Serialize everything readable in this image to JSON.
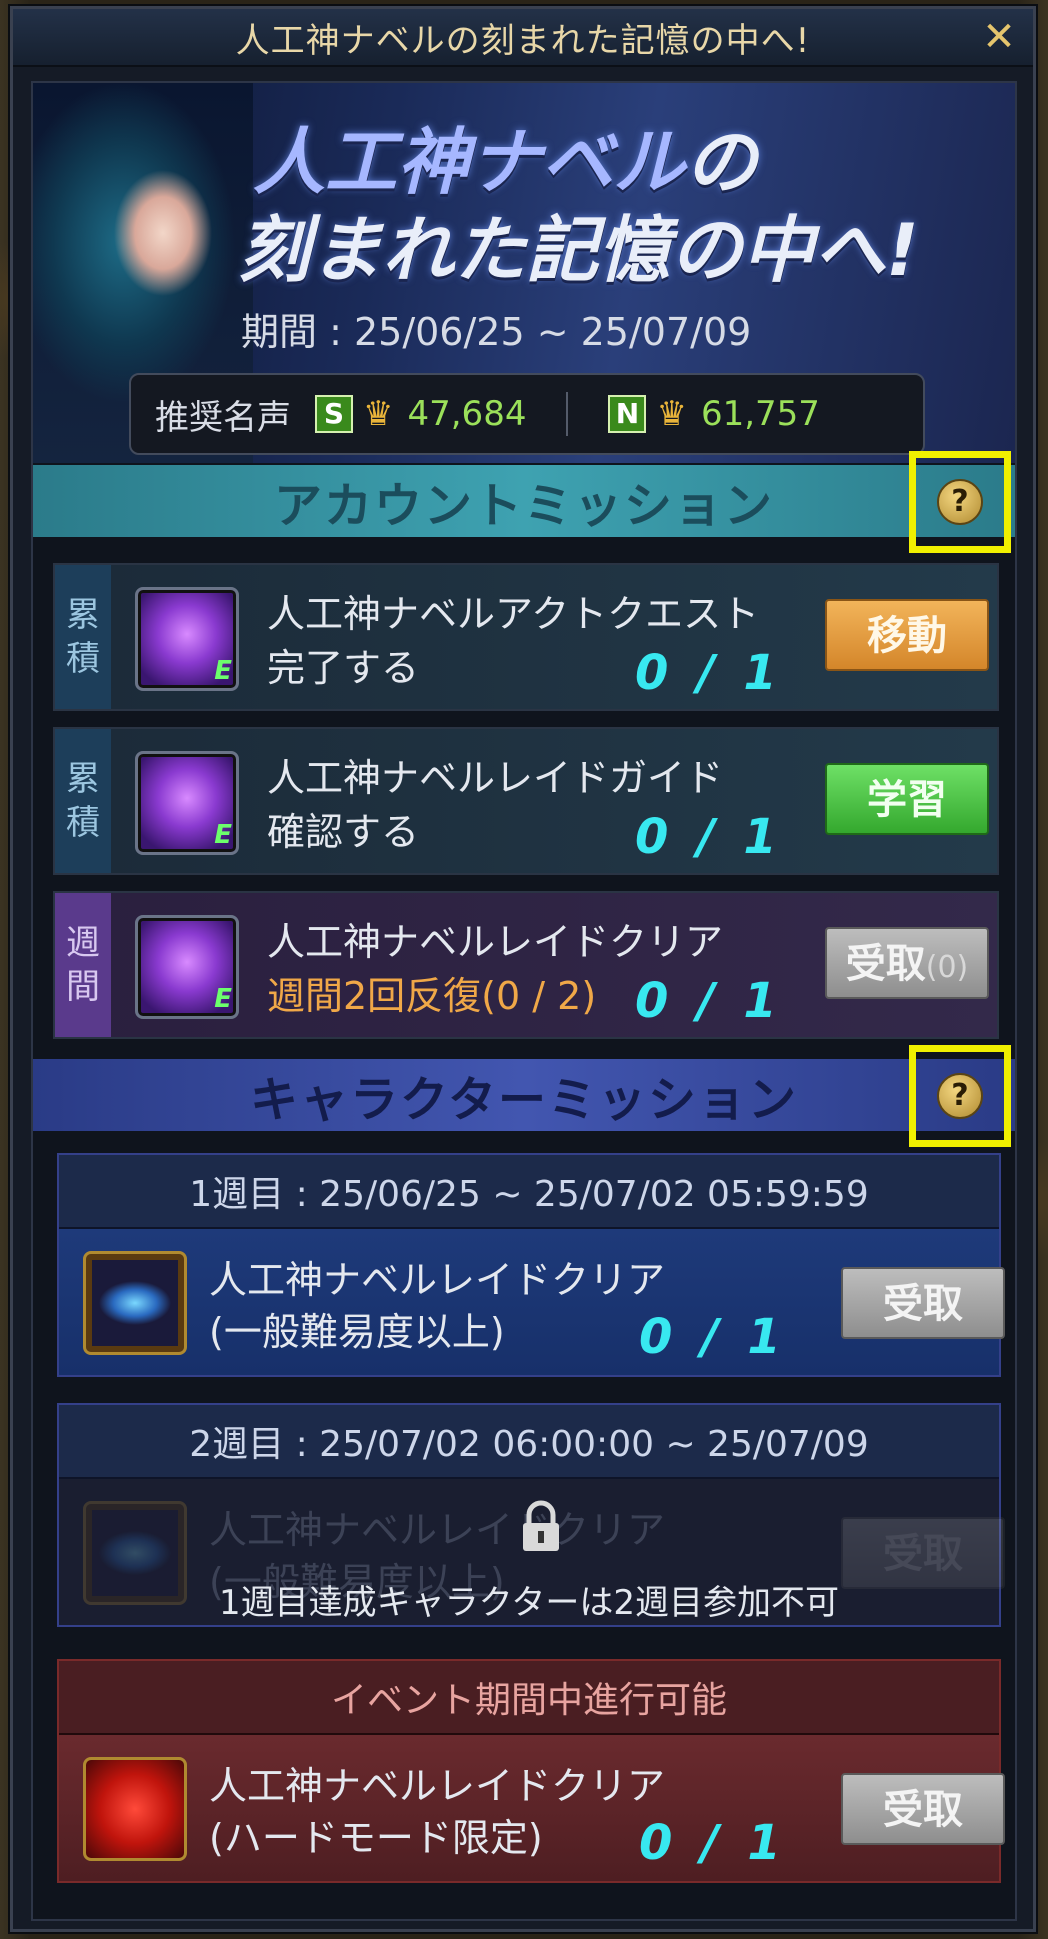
{
  "window": {
    "title": "人工神ナベルの刻まれた記憶の中へ!",
    "close_label": "✕"
  },
  "banner": {
    "title_line1_hl": "人工神ナベル",
    "title_line1_rest": "の",
    "title_line2": "刻まれた記憶の中へ!",
    "period": "期間 : 25/06/25 ~ 25/07/09",
    "fame_label": "推奨名声",
    "fame": [
      {
        "grade": "S",
        "value": "47,684",
        "color": "#9be05a"
      },
      {
        "grade": "N",
        "value": "61,757",
        "color": "#9be05a"
      }
    ]
  },
  "account_section": {
    "title": "アカウントミッション",
    "help_label": "?",
    "missions": [
      {
        "tag": [
          "累",
          "積"
        ],
        "name": "人工神ナベルアクトクエスト",
        "sub": "完了する",
        "progress": "0 / 1",
        "button": "移動",
        "button_count": ""
      },
      {
        "tag": [
          "累",
          "積"
        ],
        "name": "人工神ナベルレイドガイド",
        "sub": "確認する",
        "progress": "0 / 1",
        "button": "学習",
        "button_count": ""
      },
      {
        "tag": [
          "週",
          "間"
        ],
        "name": "人工神ナベルレイドクリア",
        "sub": "週間2回反復(0 / 2)",
        "progress": "0 / 1",
        "button": "受取",
        "button_count": "(0)"
      }
    ]
  },
  "character_section": {
    "title": "キャラクターミッション",
    "help_label": "?",
    "week1": {
      "header": "1週目 : 25/06/25 ~ 25/07/02 05:59:59",
      "name": "人工神ナベルレイドクリア",
      "sub": "(一般難易度以上)",
      "progress": "0 / 1",
      "button": "受取"
    },
    "week2": {
      "header": "2週目 : 25/07/02 06:00:00 ~ 25/07/09",
      "name": "人工神ナベルレイドクリア",
      "sub": "(一般難易度以上)",
      "button": "受取",
      "lock_note": "1週目達成キャラクターは2週目参加不可"
    },
    "event": {
      "header": "イベント期間中進行可能",
      "name": "人工神ナベルレイドクリア",
      "sub": "(ハードモード限定)",
      "progress": "0 / 1",
      "button": "受取"
    }
  },
  "icons": {
    "mission_item": "purple-gem-icon",
    "chest": "chest-icon",
    "skull": "skull-icon",
    "lock": "lock-icon",
    "fame": "fame-emblem-icon"
  }
}
